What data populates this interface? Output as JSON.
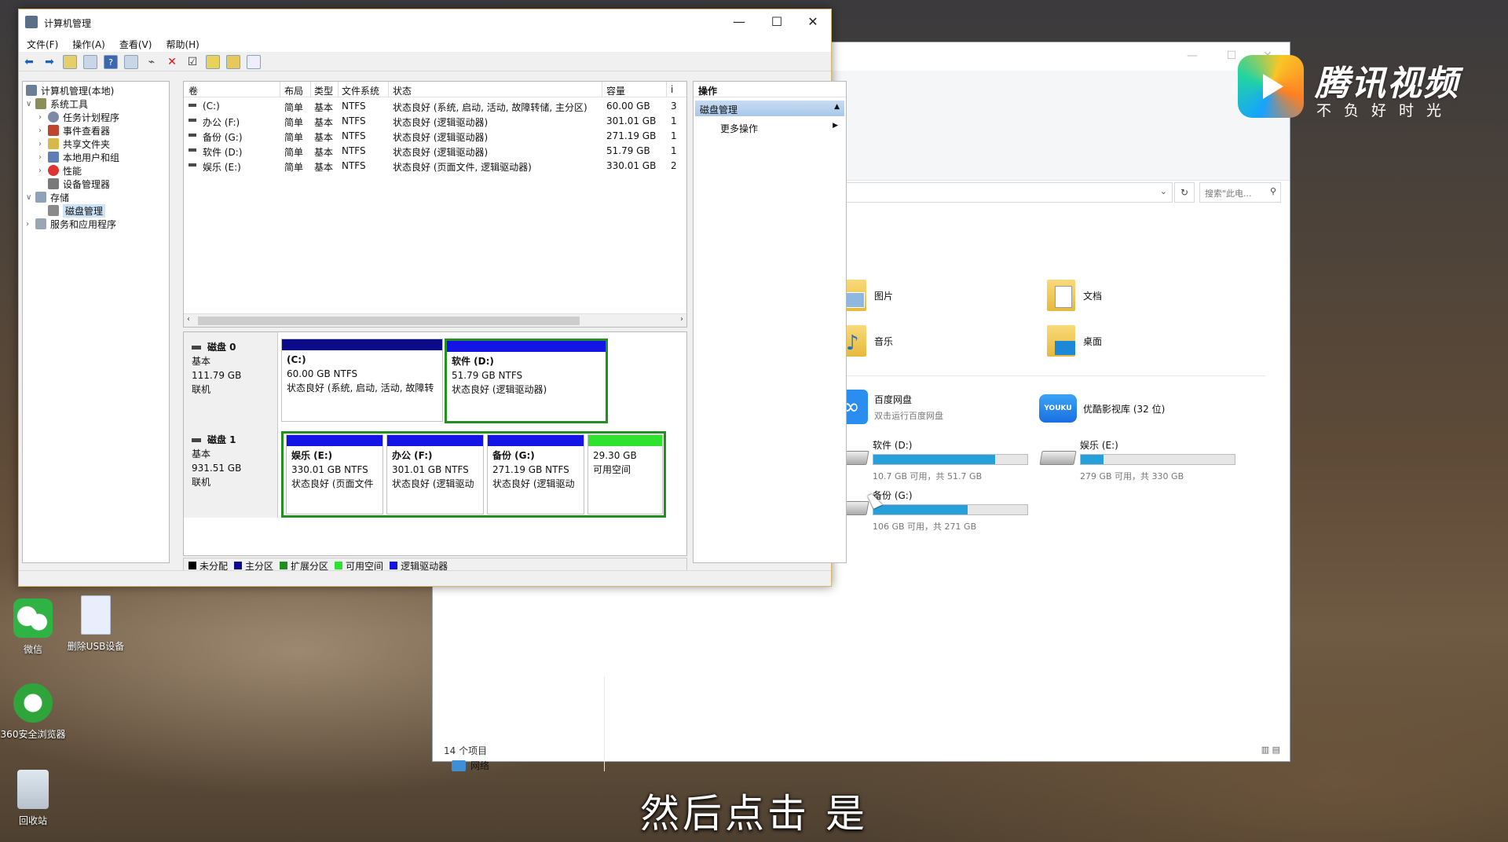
{
  "desktop": {
    "icons": [
      {
        "label": "微信"
      },
      {
        "label": "删除USB设备"
      },
      {
        "label": "360安全浏览器"
      },
      {
        "label": "回收站"
      }
    ]
  },
  "explorer": {
    "search_placeholder": "搜索\"此电...",
    "folders": [
      {
        "label": "图片",
        "icon": "pictures-folder-icon"
      },
      {
        "label": "文档",
        "icon": "documents-folder-icon"
      },
      {
        "label": "音乐",
        "icon": "music-folder-icon"
      },
      {
        "label": "桌面",
        "icon": "desktop-folder-icon"
      }
    ],
    "apps": [
      {
        "name": "百度网盘",
        "sub": "双击运行百度网盘",
        "icon_text": "∞"
      },
      {
        "name": "优酷影视库 (32 位)",
        "sub": "",
        "icon_text": "YOUKU"
      }
    ],
    "drives": [
      {
        "name": "软件 (D:)",
        "free": "10.7 GB 可用，共 51.7 GB",
        "used_fraction": 0.79
      },
      {
        "name": "娱乐 (E:)",
        "free": "279 GB 可用，共 330 GB",
        "used_fraction": 0.15
      },
      {
        "name": "备份 (G:)",
        "free": "106 GB 可用，共 271 GB",
        "used_fraction": 0.61
      }
    ],
    "network": "网络",
    "status": "14 个项目"
  },
  "disk_mgmt": {
    "title": "计算机管理",
    "menu": [
      "文件(F)",
      "操作(A)",
      "查看(V)",
      "帮助(H)"
    ],
    "tree": [
      {
        "label": "计算机管理(本地)",
        "expander": ""
      },
      {
        "label": "系统工具",
        "expander": "∨"
      },
      {
        "label": "任务计划程序",
        "expander": "›"
      },
      {
        "label": "事件查看器",
        "expander": "›"
      },
      {
        "label": "共享文件夹",
        "expander": "›"
      },
      {
        "label": "本地用户和组",
        "expander": "›"
      },
      {
        "label": "性能",
        "expander": "›"
      },
      {
        "label": "设备管理器",
        "expander": ""
      },
      {
        "label": "存储",
        "expander": "∨"
      },
      {
        "label": "磁盘管理",
        "expander": ""
      },
      {
        "label": "服务和应用程序",
        "expander": "›"
      }
    ],
    "columns": [
      "卷",
      "布局",
      "类型",
      "文件系统",
      "状态",
      "容量",
      "i"
    ],
    "volumes": [
      {
        "vol": "(C:)",
        "layout": "简单",
        "type": "基本",
        "fs": "NTFS",
        "status": "状态良好 (系统, 启动, 活动, 故障转储, 主分区)",
        "capacity": "60.00 GB",
        "extra": "3"
      },
      {
        "vol": "办公 (F:)",
        "layout": "简单",
        "type": "基本",
        "fs": "NTFS",
        "status": "状态良好 (逻辑驱动器)",
        "capacity": "301.01 GB",
        "extra": "1"
      },
      {
        "vol": "备份 (G:)",
        "layout": "简单",
        "type": "基本",
        "fs": "NTFS",
        "status": "状态良好 (逻辑驱动器)",
        "capacity": "271.19 GB",
        "extra": "1"
      },
      {
        "vol": "软件 (D:)",
        "layout": "简单",
        "type": "基本",
        "fs": "NTFS",
        "status": "状态良好 (逻辑驱动器)",
        "capacity": "51.79 GB",
        "extra": "1"
      },
      {
        "vol": "娱乐 (E:)",
        "layout": "简单",
        "type": "基本",
        "fs": "NTFS",
        "status": "状态良好 (页面文件, 逻辑驱动器)",
        "capacity": "330.01 GB",
        "extra": "2"
      }
    ],
    "disks": [
      {
        "name": "磁盘 0",
        "kind": "基本",
        "size": "111.79 GB",
        "state": "联机",
        "partitions": [
          {
            "name": "(C:)",
            "size": "60.00 GB NTFS",
            "status": "状态良好 (系统, 启动, 活动, 故障转",
            "bar": "#0b0b8a"
          },
          {
            "name": "软件  (D:)",
            "size": "51.79 GB NTFS",
            "status": "状态良好 (逻辑驱动器)",
            "bar": "#1414e6"
          }
        ]
      },
      {
        "name": "磁盘 1",
        "kind": "基本",
        "size": "931.51 GB",
        "state": "联机",
        "partitions": [
          {
            "name": "娱乐  (E:)",
            "size": "330.01 GB NTFS",
            "status": "状态良好 (页面文件",
            "bar": "#1414e6"
          },
          {
            "name": "办公  (F:)",
            "size": "301.01 GB NTFS",
            "status": "状态良好 (逻辑驱动",
            "bar": "#1414e6"
          },
          {
            "name": "备份  (G:)",
            "size": "271.19 GB NTFS",
            "status": "状态良好 (逻辑驱动",
            "bar": "#1414e6"
          },
          {
            "name": "",
            "size": "29.30 GB",
            "status": "可用空间",
            "bar": "#2ee22e"
          }
        ]
      }
    ],
    "legend": [
      {
        "label": "未分配",
        "color": "#000000"
      },
      {
        "label": "主分区",
        "color": "#0b0b8a"
      },
      {
        "label": "扩展分区",
        "color": "#1f8f1f"
      },
      {
        "label": "可用空间",
        "color": "#2ee22e"
      },
      {
        "label": "逻辑驱动器",
        "color": "#1414e6"
      }
    ],
    "ops": {
      "header": "操作",
      "section": "磁盘管理",
      "item": "更多操作"
    }
  },
  "overlay": {
    "logo_name": "腾讯视频",
    "logo_slogan": "不负好时光",
    "subtitle": "然后点击 是"
  }
}
